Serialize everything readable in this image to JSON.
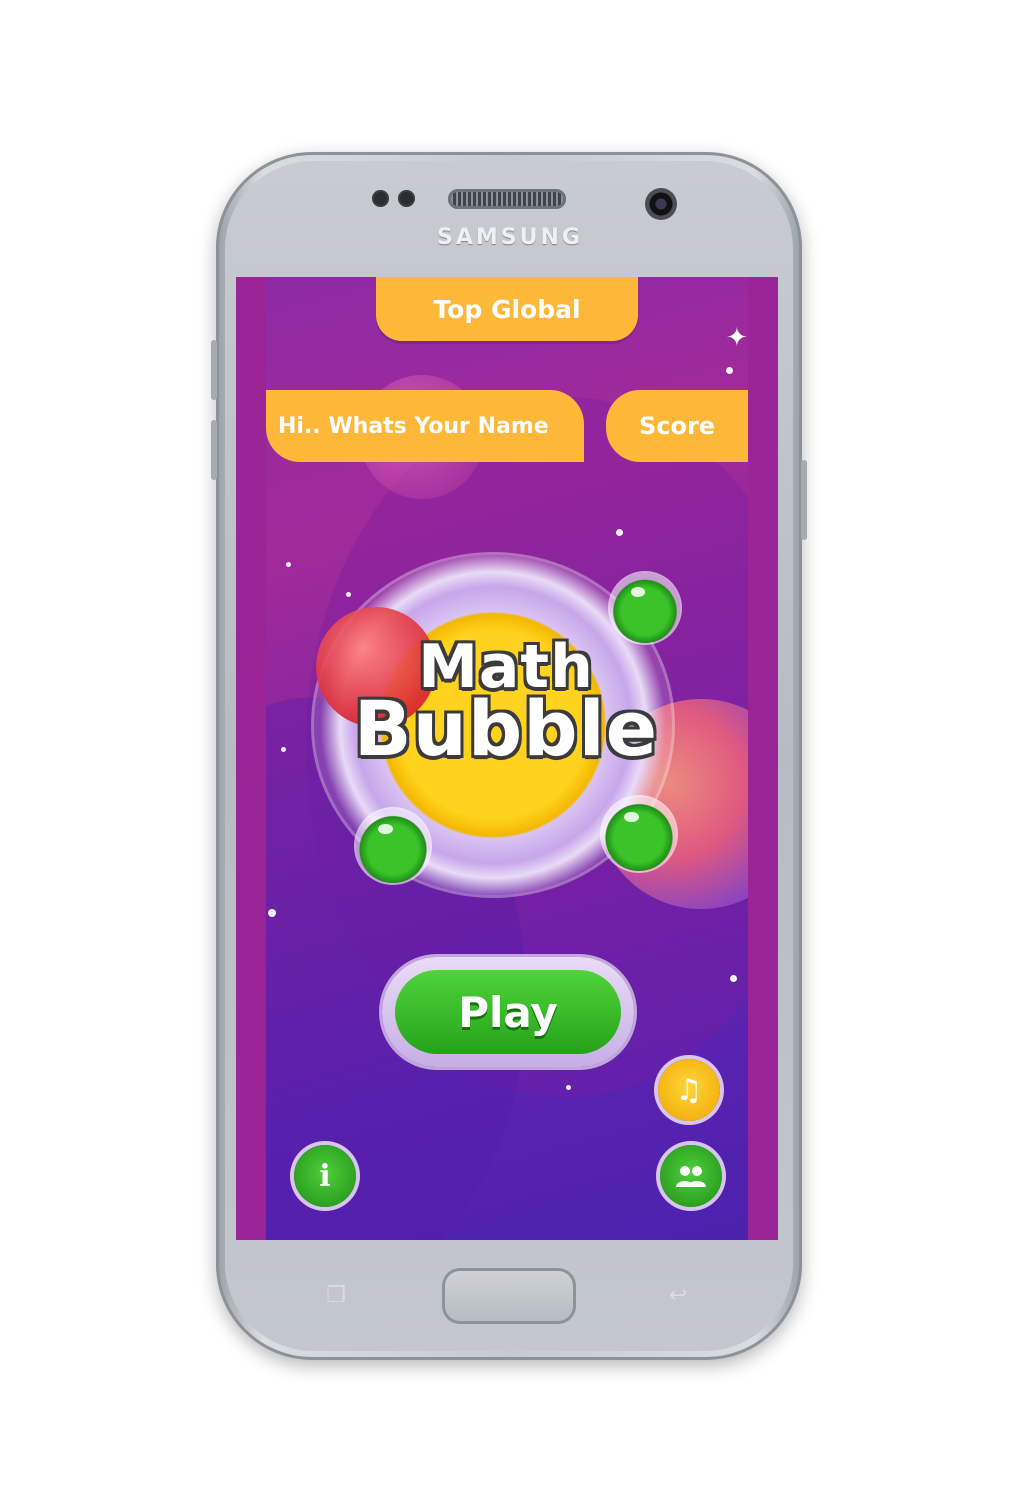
{
  "device": {
    "brand": "SAMSUNG"
  },
  "header": {
    "top_global_label": "Top Global"
  },
  "player": {
    "name_placeholder": "Hi.. Whats Your Name",
    "score_label": "Score"
  },
  "logo": {
    "line1": "Math",
    "line2": "Bubble"
  },
  "actions": {
    "play_label": "Play"
  },
  "icons": {
    "music": "music-icon",
    "info": "info-icon",
    "users": "users-icon"
  },
  "colors": {
    "accent_orange": "#fdb83a",
    "play_green": "#26a21a",
    "background_purple": "#7d24a3"
  }
}
